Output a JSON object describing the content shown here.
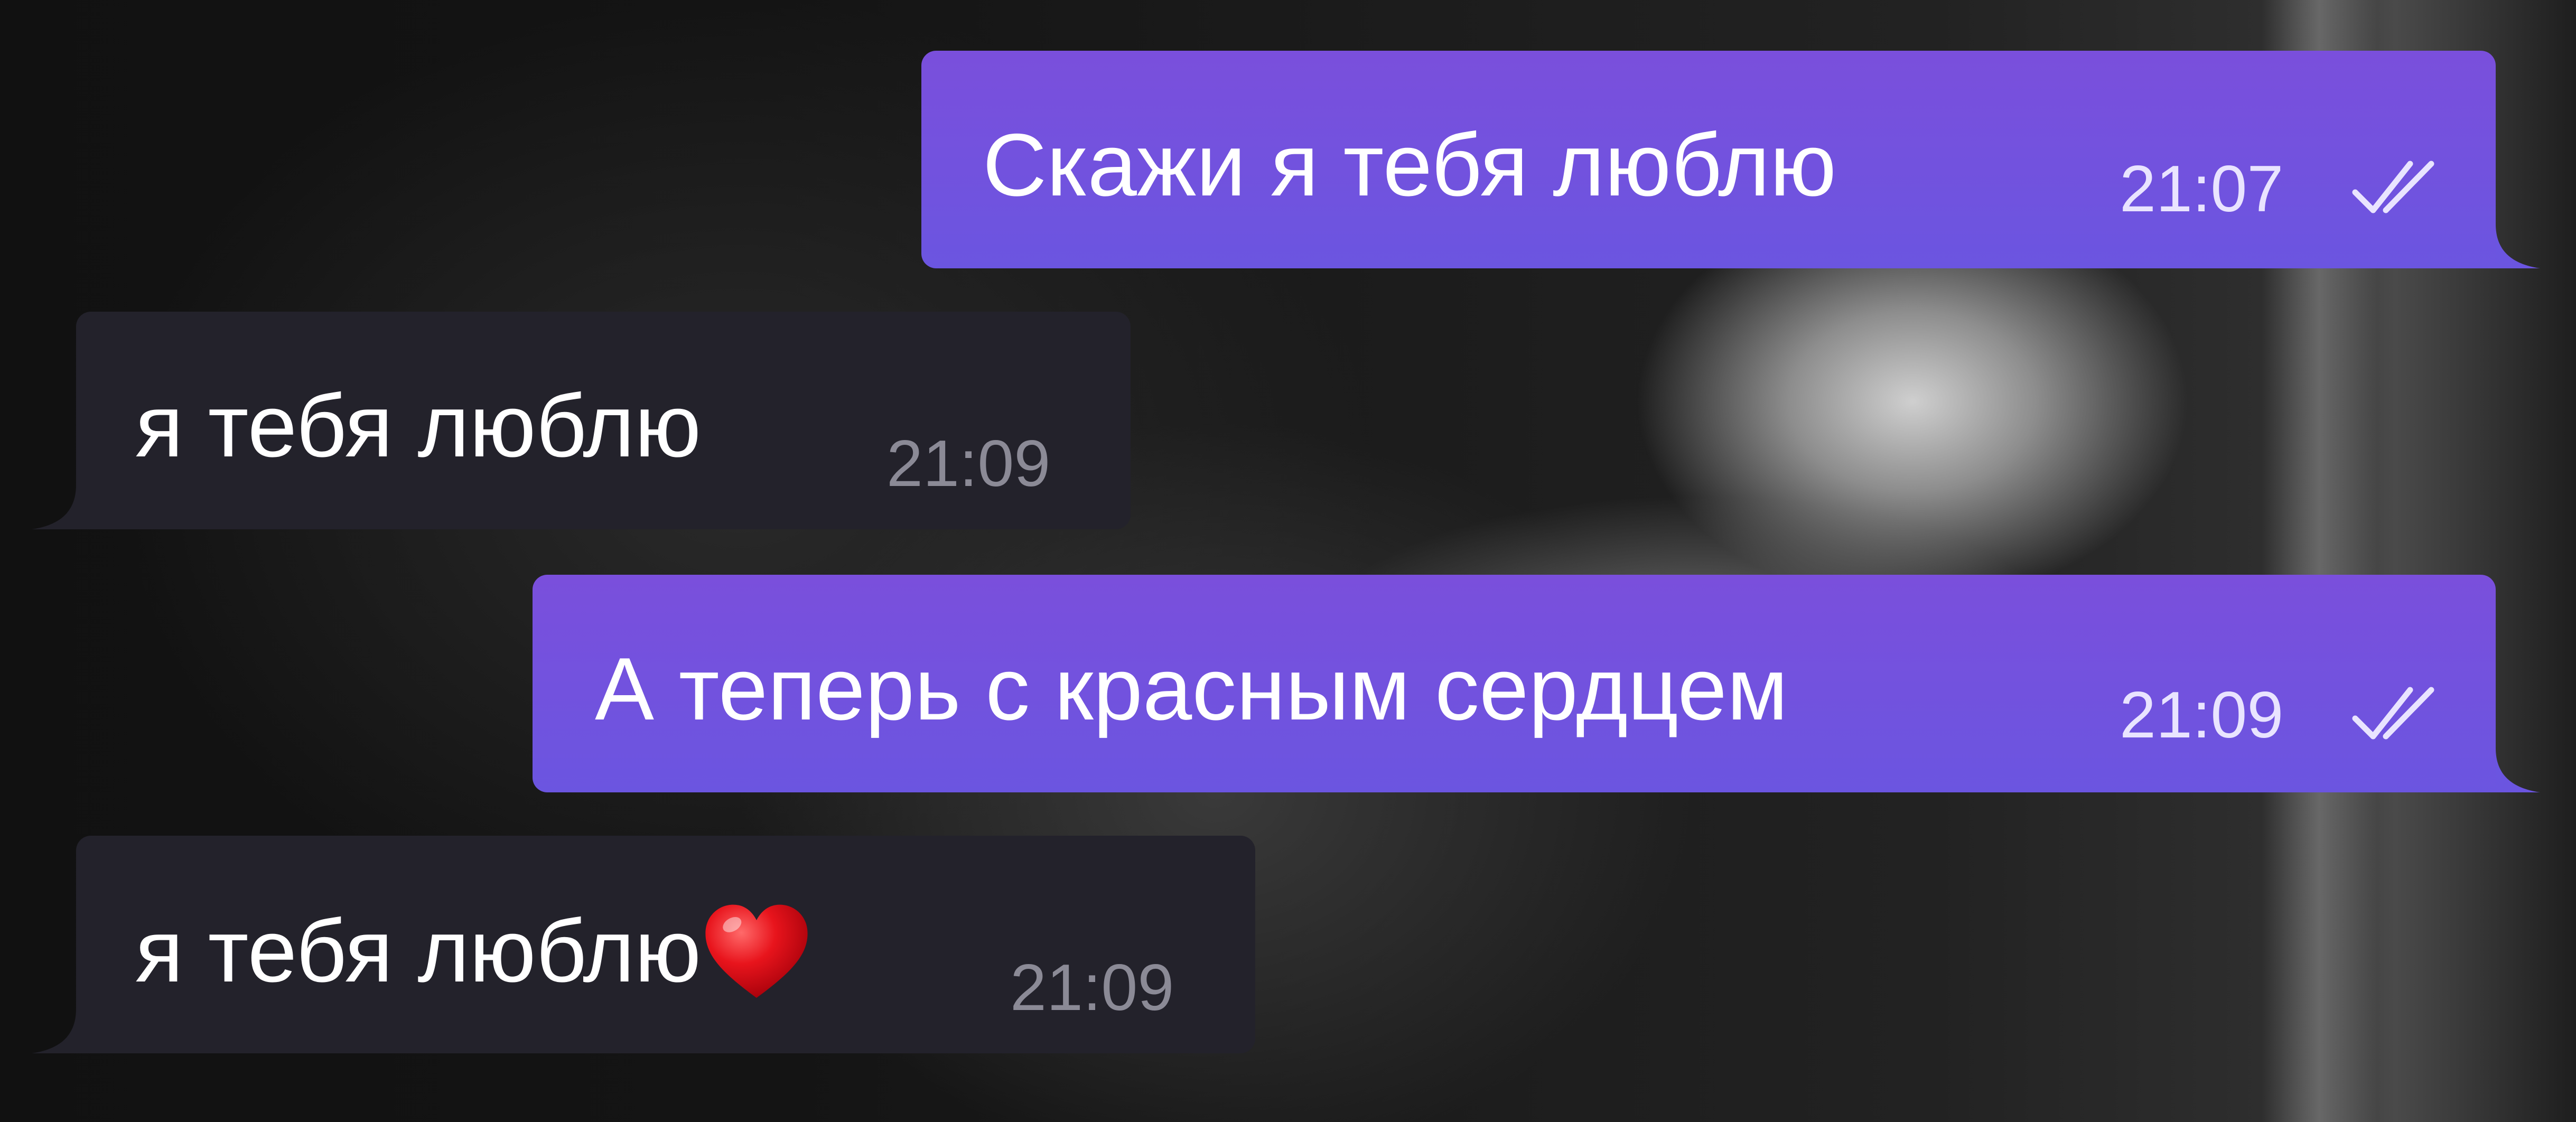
{
  "messages": [
    {
      "direction": "outgoing",
      "text": "Скажи  я тебя люблю",
      "time": "21:07",
      "status": "read"
    },
    {
      "direction": "incoming",
      "text": "я тебя люблю",
      "time": "21:09"
    },
    {
      "direction": "outgoing",
      "text": "А теперь с красным сердцем",
      "time": "21:09",
      "status": "read"
    },
    {
      "direction": "incoming",
      "text": "я тебя люблю",
      "emoji": "red-heart-icon",
      "time": "21:09"
    }
  ],
  "colors": {
    "outgoing_bubble": "#6b55e0",
    "incoming_bubble": "#23222b",
    "incoming_time": "#8b8a96",
    "heart": "#e8141c"
  }
}
